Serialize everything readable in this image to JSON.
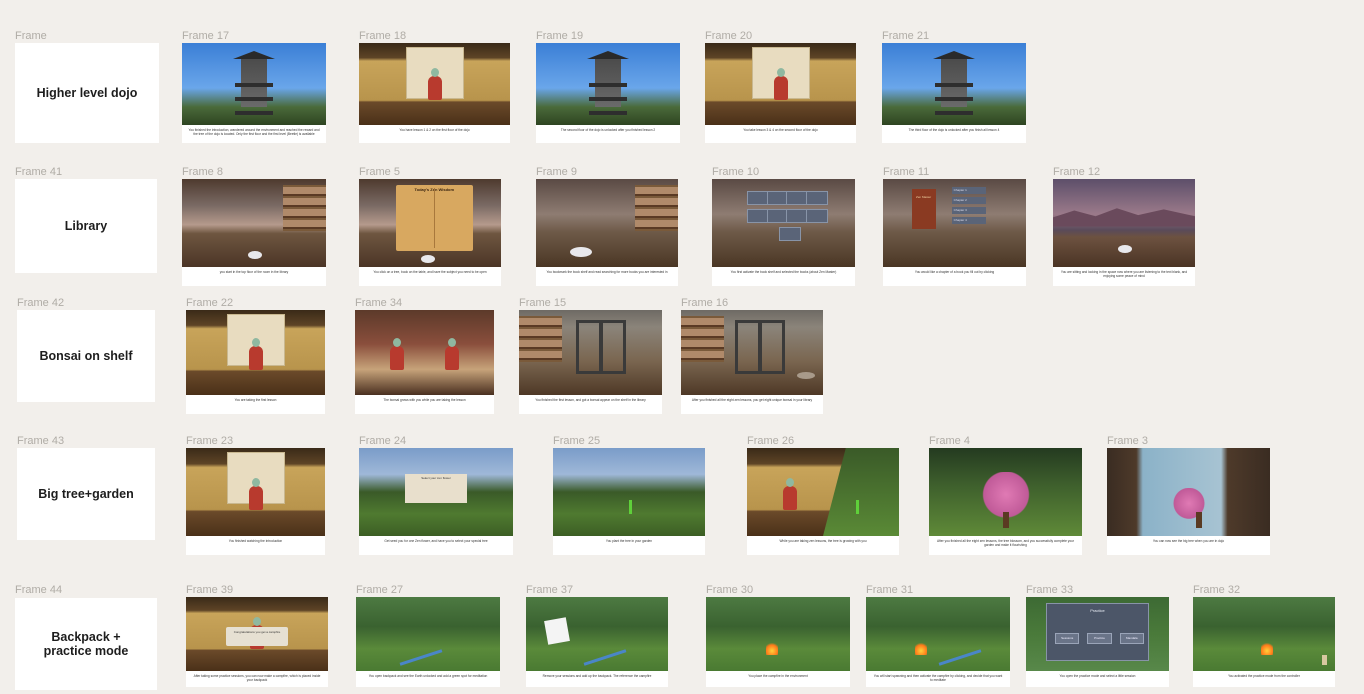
{
  "rows": [
    {
      "label": "Frame",
      "title_lines": [
        "Higher level dojo"
      ],
      "frames": [
        {
          "label": "Frame 17",
          "scene": "dojo",
          "caption": "You finished the introduction, wandered around the environment and reached the reward and the tree of the dojo is located. Only the first floor and the first level (Beetle) is available"
        },
        {
          "label": "Frame 18",
          "scene": "room",
          "caption": "You have lesson 1 & 2 on the first floor of the dojo"
        },
        {
          "label": "Frame 19",
          "scene": "dojo",
          "caption": "The second floor of the dojo is unlocked after you finished lesson 2"
        },
        {
          "label": "Frame 20",
          "scene": "room",
          "caption": "You take lesson 3 & 4 on the second floor of the dojo"
        },
        {
          "label": "Frame 21",
          "scene": "dojo",
          "caption": "The third floor of the dojo is unlocked after you finish all lesson 4"
        }
      ]
    },
    {
      "label": "Frame 41",
      "title_lines": [
        "Library"
      ],
      "frames": [
        {
          "label": "Frame 8",
          "scene": "lib",
          "caption": "you start in the top floor of the room in the library"
        },
        {
          "label": "Frame 5",
          "scene": "book",
          "caption": "You click on a tree, book on the table, and have the subject you need to be open"
        },
        {
          "label": "Frame 9",
          "scene": "lib2",
          "caption": "You bookmark the book shelf and read searching for more books you are interested in"
        },
        {
          "label": "Frame 10",
          "scene": "menu",
          "caption": "You first activate the book shelf and selected the books (about Zen Master)"
        },
        {
          "label": "Frame 11",
          "scene": "chapters",
          "caption": "You would like a chapter of a book you fill out by clicking"
        },
        {
          "label": "Frame 12",
          "scene": "sky",
          "caption": "You are sitting and looking in the space now where you are listening to the text blank, and enjoying some peace of mind"
        }
      ]
    },
    {
      "label": "Frame 42",
      "title_lines": [
        "Bonsai on shelf"
      ],
      "frames": [
        {
          "label": "Frame 22",
          "scene": "room",
          "caption": "You are taking the first lesson"
        },
        {
          "label": "Frame 34",
          "scene": "red",
          "caption": "The bonsai grows with you while you are taking the lesson"
        },
        {
          "label": "Frame 15",
          "scene": "shelf",
          "caption": "You finished the first lesson, and got a bonsai appear on the shelf in the library"
        },
        {
          "label": "Frame 16",
          "scene": "shelf2",
          "caption": "After you finished all the eight zen lessons, you get eight unique bonsai in your library"
        }
      ]
    },
    {
      "label": "Frame 43",
      "title_lines": [
        "Big tree+garden"
      ],
      "frames": [
        {
          "label": "Frame 23",
          "scene": "room",
          "caption": "You finished watching the introduction"
        },
        {
          "label": "Frame 24",
          "scene": "snack",
          "caption": "Get seed you for one Zen flower, and have you to select your special tree"
        },
        {
          "label": "Frame 25",
          "scene": "sapling",
          "caption": "You plant the tree in your garden"
        },
        {
          "label": "Frame 26",
          "scene": "split",
          "caption": "While you are taking zen lessons, the tree is growing with you"
        },
        {
          "label": "Frame 4",
          "scene": "blossom",
          "caption": "After you finished all the eight zen lessons, the tree blossom, and you successfully complete your garden and make it flourishing"
        },
        {
          "label": "Frame 3",
          "scene": "window",
          "caption": "You can now see the big tree when you are in dojo"
        }
      ]
    },
    {
      "label": "Frame 44",
      "title_lines": [
        "Backpack +",
        "practice mode"
      ],
      "frames": [
        {
          "label": "Frame 39",
          "scene": "popup",
          "caption": "After taking some practice sessions, you can now make a campfire, which is placed inside your backpack"
        },
        {
          "label": "Frame 27",
          "scene": "wand",
          "caption": "You open backpack and see the Earth unlocked and add a green spot for meditation"
        },
        {
          "label": "Frame 37",
          "scene": "paper",
          "caption": "Remove your sessions and add up the backpack. The reference the campfire"
        },
        {
          "label": "Frame 30",
          "scene": "camp",
          "caption": "You place the campfire in the environment"
        },
        {
          "label": "Frame 31",
          "scene": "campwand",
          "caption": "You will start spawning and then activate the campfire by clicking, and decide that you want to meditate"
        },
        {
          "label": "Frame 33",
          "scene": "practice",
          "caption": "You open the practice mode and select a little session"
        },
        {
          "label": "Frame 32",
          "scene": "camp2",
          "caption": "You activated the practice mode from the controller"
        }
      ]
    }
  ],
  "overlays": {
    "frame5_title": "Today's Zen Wisdom",
    "frame11_book": "Zen Master",
    "frame11_chapters": [
      "Chapter 1",
      "Chapter 2",
      "Chapter 3",
      "Chapter 4"
    ],
    "frame33_title": "Practice",
    "frame33_options": [
      "Sessions",
      "Practice",
      "Mandala"
    ],
    "frame24_title": "Select your zen flower",
    "frame39_title": "Congratulations you get a campfire"
  }
}
